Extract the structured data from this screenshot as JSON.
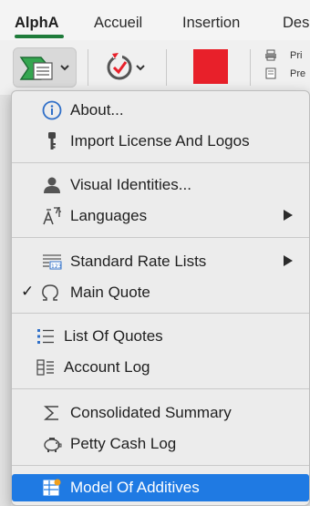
{
  "ribbon": {
    "tabs": [
      {
        "label": "AlphA"
      },
      {
        "label": "Accueil"
      },
      {
        "label": "Insertion"
      },
      {
        "label": "Des"
      }
    ],
    "right_items": [
      "Pri",
      "Pre"
    ]
  },
  "menu": {
    "items": [
      {
        "label": "About...",
        "icon": "info-circle-icon"
      },
      {
        "label": "Import License And Logos",
        "icon": "key-icon"
      },
      {
        "label": "Visual Identities...",
        "icon": "person-icon"
      },
      {
        "label": "Languages",
        "icon": "translate-icon",
        "submenu": true
      },
      {
        "label": "Standard Rate Lists",
        "icon": "rate-list-icon",
        "submenu": true
      },
      {
        "label": "Main Quote",
        "icon": "omega-icon",
        "checked": true
      },
      {
        "label": "List Of Quotes",
        "icon": "list-icon"
      },
      {
        "label": "Account Log",
        "icon": "account-log-icon"
      },
      {
        "label": "Consolidated Summary",
        "icon": "sigma-icon"
      },
      {
        "label": "Petty Cash Log",
        "icon": "piggy-bank-icon"
      },
      {
        "label": "Model Of Additives",
        "icon": "table-star-icon",
        "selected": true
      }
    ]
  },
  "colors": {
    "accent_green": "#1e7b3a",
    "selection_blue": "#1f7ae3",
    "red_swatch": "#e8202a"
  }
}
